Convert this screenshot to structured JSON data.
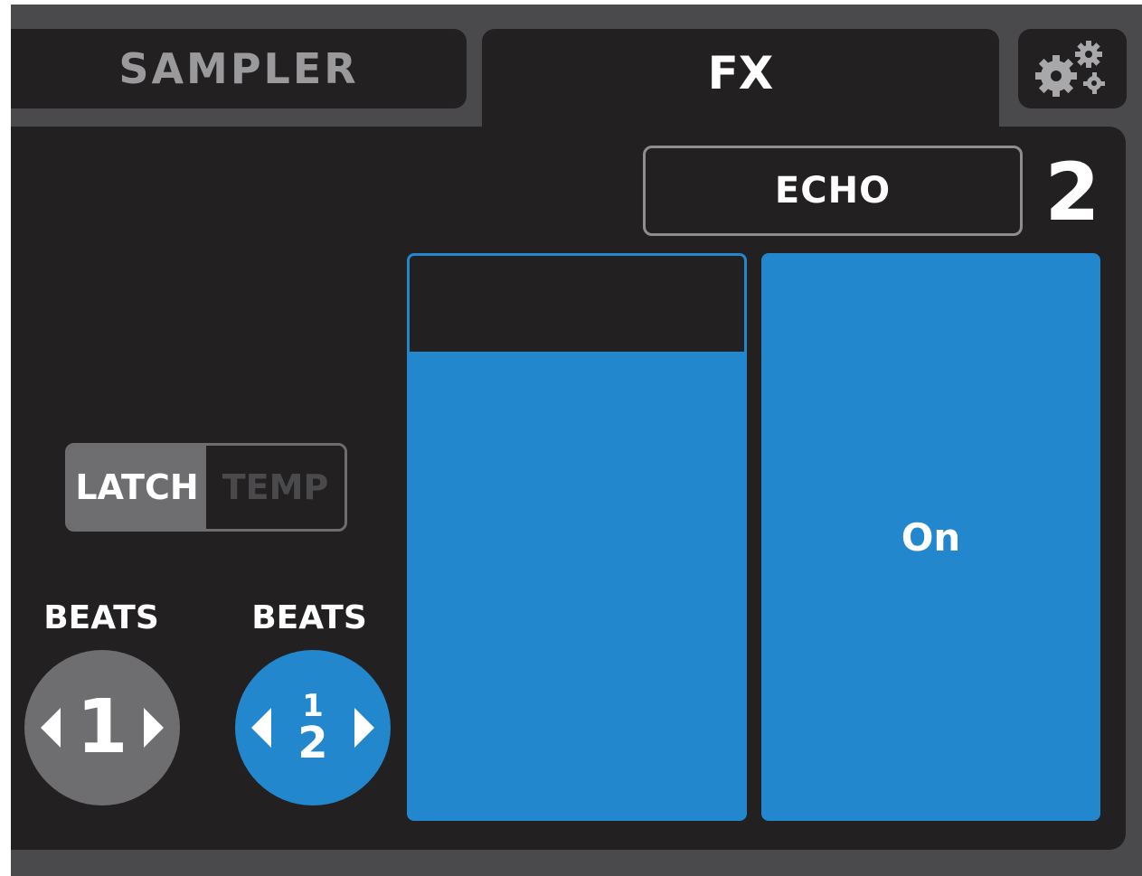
{
  "tabs": {
    "sampler_label": "SAMPLER",
    "fx_label": "FX",
    "settings_icon": "gears-icon"
  },
  "effect": {
    "name": "ECHO",
    "deck_number": "2"
  },
  "fx_slider": {
    "level_fraction": 0.83
  },
  "on_button": {
    "label": "On"
  },
  "mode_toggle": {
    "options": [
      "LATCH",
      "TEMP"
    ],
    "selected": "LATCH"
  },
  "beats_left": {
    "label": "BEATS",
    "value": "1"
  },
  "beats_right": {
    "label": "BEATS",
    "numerator": "1",
    "denominator": "2"
  },
  "colors": {
    "frame": "#4a4a4c",
    "panel": "#222020",
    "accent": "#2287cc",
    "inactive": "#6e6e70"
  }
}
